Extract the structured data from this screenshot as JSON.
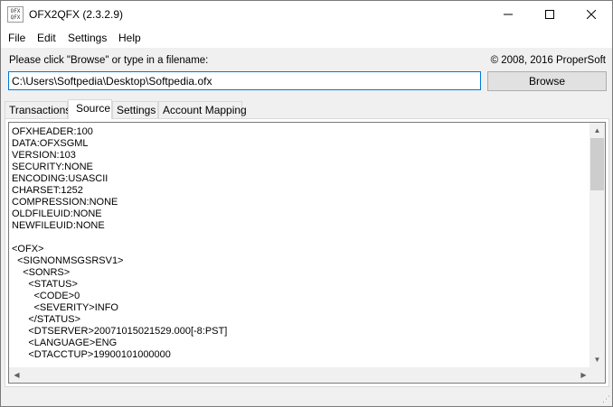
{
  "window": {
    "title": "OFX2QFX (2.3.2.9)",
    "icon_top": "OFX",
    "icon_bottom": "QFX"
  },
  "menu": [
    "File",
    "Edit",
    "Settings",
    "Help"
  ],
  "prompt_label": "Please click \"Browse\" or type in a filename:",
  "copyright": "© 2008, 2016 ProperSoft",
  "file_input_value": "C:\\Users\\Softpedia\\Desktop\\Softpedia.ofx",
  "browse_label": "Browse",
  "tabs": [
    "Transactions",
    "Source",
    "Settings",
    "Account Mapping"
  ],
  "active_tab": "Source",
  "source_lines": [
    "OFXHEADER:100",
    "DATA:OFXSGML",
    "VERSION:103",
    "SECURITY:NONE",
    "ENCODING:USASCII",
    "CHARSET:1252",
    "COMPRESSION:NONE",
    "OLDFILEUID:NONE",
    "NEWFILEUID:NONE",
    "",
    "<OFX>",
    "  <SIGNONMSGSRSV1>",
    "    <SONRS>",
    "      <STATUS>",
    "        <CODE>0",
    "        <SEVERITY>INFO",
    "      </STATUS>",
    "      <DTSERVER>20071015021529.000[-8:PST]",
    "      <LANGUAGE>ENG",
    "      <DTACCTUP>19900101000000"
  ],
  "icons": {
    "minimize": "minimize-icon",
    "maximize": "maximize-icon",
    "close": "close-icon"
  }
}
